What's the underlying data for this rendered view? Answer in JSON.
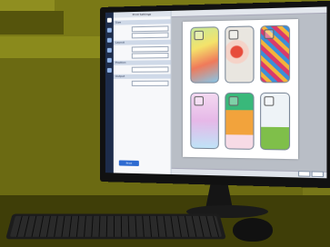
{
  "scene": "desktop-computer-photo",
  "app": {
    "panel_title": "Print Settings",
    "sections": [
      {
        "label": "Size"
      },
      {
        "label": "Layout"
      },
      {
        "label": "Position"
      },
      {
        "label": "Output"
      }
    ],
    "action_label": "Print",
    "rail_icons": [
      "layout-icon",
      "image-icon",
      "text-icon",
      "crop-icon",
      "color-icon",
      "print-icon"
    ]
  },
  "colors": {
    "background": "#7a7916",
    "rail": "#1d2c4a",
    "accent": "#2e6bd1"
  }
}
